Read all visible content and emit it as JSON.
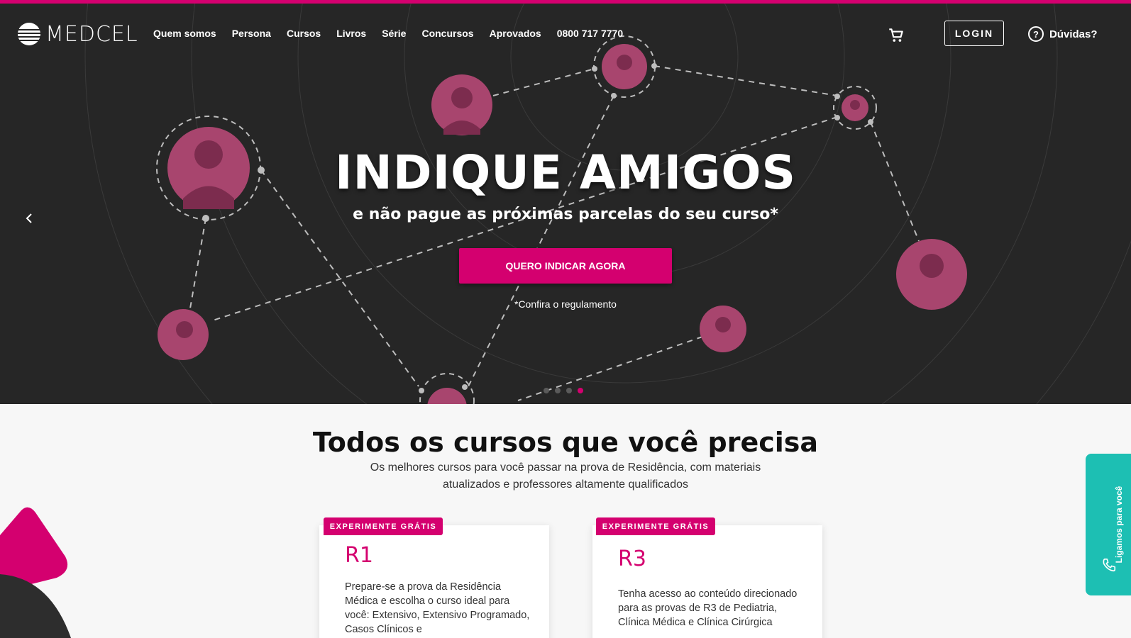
{
  "brand": {
    "name": "MEDCEL"
  },
  "nav": {
    "items": [
      "Quem somos",
      "Persona",
      "Cursos",
      "Livros",
      "Série",
      "Concursos",
      "Aprovados",
      "0800 717 7770"
    ],
    "login_label": "LOGIN",
    "help_label": "Dúvidas?"
  },
  "hero": {
    "title": "INDIQUE AMIGOS",
    "subtitle": "e não pague as próximas parcelas do seu curso*",
    "cta_label": "QUERO INDICAR AGORA",
    "rules_text": "*Confira o regulamento",
    "slides_total": 4,
    "slide_active": 4
  },
  "courses": {
    "title": "Todos os cursos que você precisa",
    "description": "Os melhores cursos para você passar na prova de Residência, com materiais atualizados e professores altamente qualificados",
    "cards": [
      {
        "badge": "EXPERIMENTE GRÁTIS",
        "title": "R1",
        "text": "Prepare-se a prova da Residência Médica e escolha o curso ideal para você: Extensivo, Extensivo Programado, Casos Clínicos e"
      },
      {
        "badge": "EXPERIMENTE GRÁTIS",
        "title": "R3",
        "text": "Tenha acesso ao conteúdo direcionado para as provas de R3 de Pediatria, Clínica Médica e Clínica Cirúrgica"
      }
    ]
  },
  "callback": {
    "label": "Ligamos para você"
  },
  "colors": {
    "accent": "#d4006f",
    "hero_bg": "#262626",
    "callback": "#1dbfb3"
  },
  "icons": [
    "medcel-logo-icon",
    "cart-icon",
    "help-icon",
    "chevron-left-icon",
    "phone-icon"
  ]
}
